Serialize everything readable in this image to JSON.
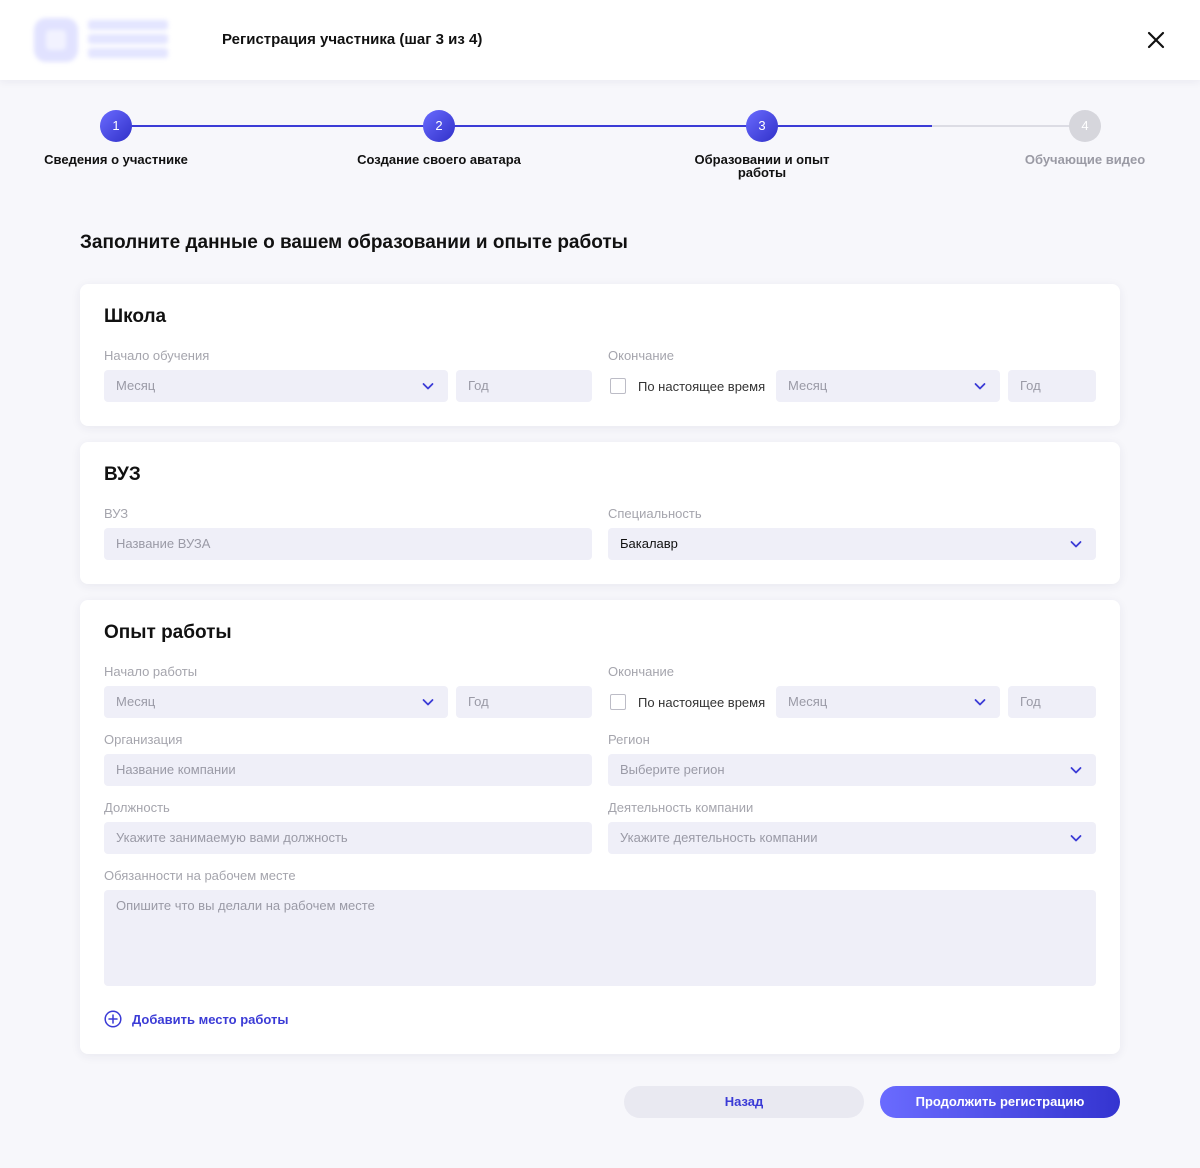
{
  "header": {
    "title": "Регистрация участника (шаг 3 из 4)",
    "close_icon": "close-icon"
  },
  "stepper": {
    "steps": [
      {
        "number": "1",
        "label": "Сведения о участнике",
        "state": "done"
      },
      {
        "number": "2",
        "label": "Создание своего аватара",
        "state": "done"
      },
      {
        "number": "3",
        "label": "Образовании и опыт работы",
        "state": "current"
      },
      {
        "number": "4",
        "label": "Обучающие видео",
        "state": "upcoming"
      }
    ]
  },
  "page_heading": "Заполните данные о вашем образовании и опыте работы",
  "school": {
    "title": "Школа",
    "start_label": "Начало  обучения",
    "start_month_placeholder": "Месяц",
    "start_year_placeholder": "Год",
    "end_label": "Окончание",
    "present_label": "По настоящее время",
    "end_month_placeholder": "Месяц",
    "end_year_placeholder": "Год"
  },
  "university": {
    "title": "ВУЗ",
    "name_label": "ВУЗ",
    "name_placeholder": "Название ВУЗА",
    "specialty_label": "Специальность",
    "specialty_value": "Бакалавр"
  },
  "work": {
    "title": "Опыт работы",
    "start_label": "Начало работы",
    "start_month_placeholder": "Месяц",
    "start_year_placeholder": "Год",
    "end_label": "Окончание",
    "present_label": "По настоящее время",
    "end_month_placeholder": "Месяц",
    "end_year_placeholder": "Год",
    "org_label": "Организация",
    "org_placeholder": "Название компании",
    "region_label": "Регион",
    "region_placeholder": "Выберите регион",
    "position_label": "Должность",
    "position_placeholder": "Укажите занимаемую вами должность",
    "activity_label": "Деятельность компании",
    "activity_placeholder": "Укажите деятельность компании",
    "duties_label": "Обязанности на рабочем месте",
    "duties_placeholder": "Опишите что вы делали на рабочем месте",
    "add_label": "Добавить место работы"
  },
  "footer": {
    "back_label": "Назад",
    "next_label": "Продолжить регистрацию"
  },
  "colors": {
    "accent": "#3b3bd6",
    "accent_light": "#6a6bff",
    "field_bg": "#efeff8",
    "page_bg": "#f7f7fb"
  }
}
